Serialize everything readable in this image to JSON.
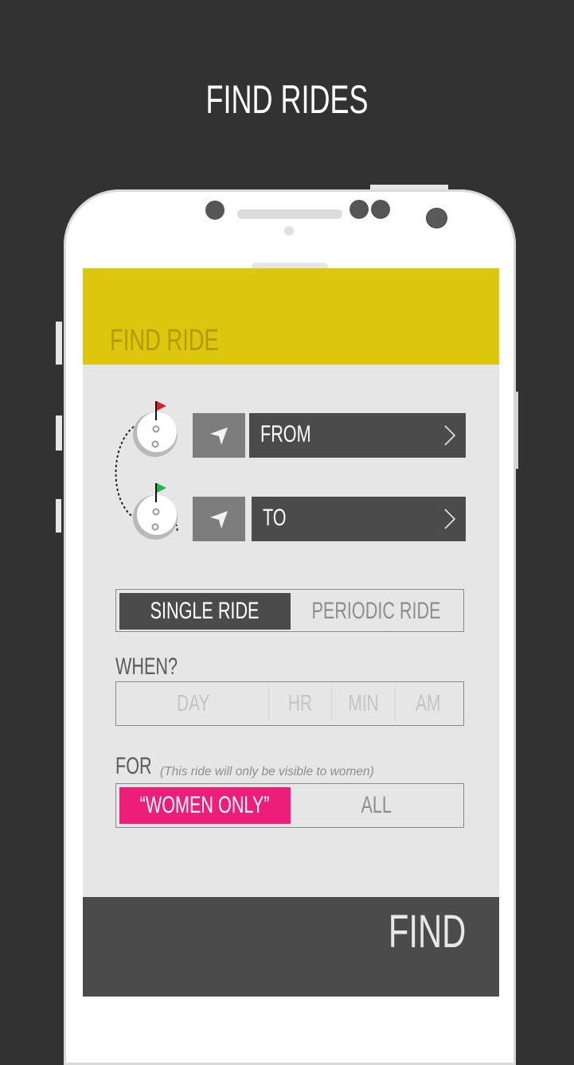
{
  "page": {
    "title": "FIND RIDES"
  },
  "app": {
    "header_title": "FIND RIDE",
    "colors": {
      "header": "#dfc60e",
      "header_text": "#b49b06",
      "dark": "#4b4b4b",
      "accent_pink": "#ec1e79",
      "background": "#e6e6e6"
    }
  },
  "route": {
    "from": {
      "label": "FROM",
      "locate_icon": "navigation-arrow-icon",
      "chevron": "chevron-right-icon",
      "flag_color": "#d3212d"
    },
    "to": {
      "label": "TO",
      "locate_icon": "navigation-arrow-icon",
      "chevron": "chevron-right-icon",
      "flag_color": "#27b34b"
    }
  },
  "ride_type": {
    "options": [
      "SINGLE RIDE",
      "PERIODIC RIDE"
    ],
    "selected": "SINGLE RIDE"
  },
  "when": {
    "label": "WHEN?",
    "placeholders": {
      "day": "DAY",
      "hour": "HR",
      "minute": "MIN",
      "ampm": "AM"
    }
  },
  "for": {
    "label": "FOR",
    "hint": "(This ride will only be visible to women)",
    "options": [
      "“WOMEN ONLY”",
      "ALL"
    ],
    "selected": "“WOMEN ONLY”"
  },
  "actions": {
    "find_label": "FIND"
  }
}
